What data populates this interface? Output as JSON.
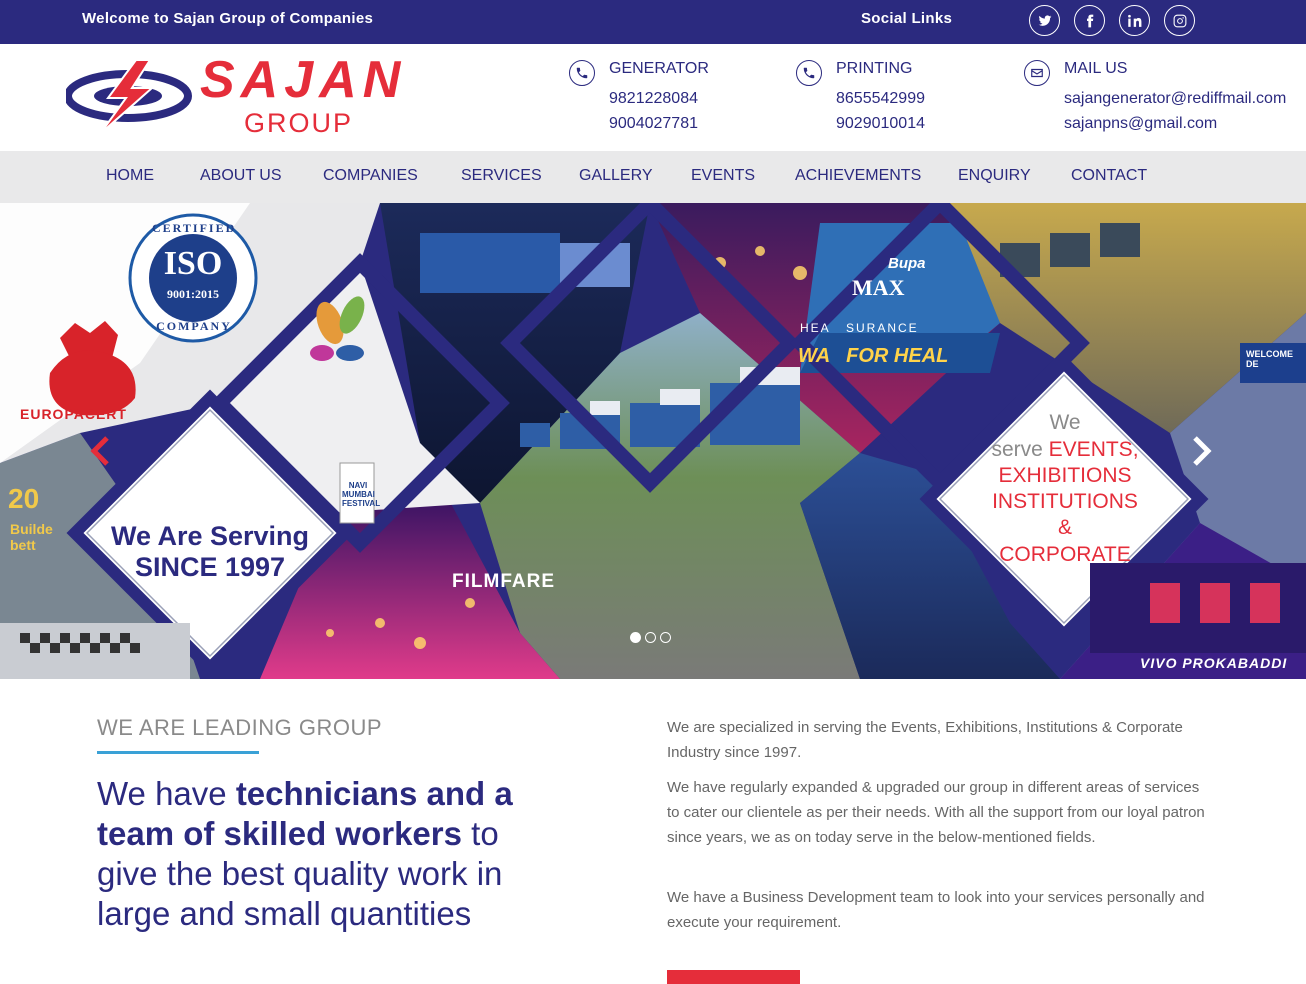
{
  "topbar": {
    "welcome": "Welcome to Sajan Group of Companies",
    "social_label": "Social Links",
    "social_icons": [
      "twitter-icon",
      "facebook-icon",
      "linkedin-icon",
      "instagram-icon"
    ]
  },
  "logo": {
    "word": "SAJAN",
    "sub": "GROUP"
  },
  "contacts": [
    {
      "title": "GENERATOR",
      "lines": [
        "9821228084",
        "9004027781"
      ],
      "icon": "phone-icon"
    },
    {
      "title": "PRINTING",
      "lines": [
        "8655542999",
        "9029010014"
      ],
      "icon": "phone-icon"
    },
    {
      "title": "MAIL US",
      "lines": [
        "sajangenerator@rediffmail.com",
        "sajanpns@gmail.com"
      ],
      "icon": "mail-icon"
    }
  ],
  "nav": [
    "HOME",
    "ABOUT US",
    "COMPANIES",
    "SERVICES",
    "GALLERY",
    "EVENTS",
    "ACHIEVEMENTS",
    "ENQUIRY",
    "CONTACT"
  ],
  "banner": {
    "iso_top": "CERTIFIED",
    "iso_main": "ISO",
    "iso_num": "9001:2015",
    "iso_bottom": "COMPANY",
    "europacert": "EUROPACERT",
    "serving_line1": "We Are Serving",
    "serving_line2": "SINCE 1997",
    "serve_we": "We",
    "serve_line": "serve",
    "serve_events": "EVENTS,",
    "serve_exhibitions": "EXHIBITIONS",
    "serve_institutions": "INSTITUTIONS",
    "serve_amp": "&",
    "serve_corporate": "CORPORATE",
    "filmfare": "FILMFARE",
    "bupa": "Bupa",
    "max": "MAX",
    "insurance": "HEA   SURANCE",
    "walk": "WA   FOR HEAL",
    "welcome_de": "WELCOME DE",
    "navi": "NAVI MUMBAI FESTIVAL",
    "twenty": "20",
    "build": "Builde bett",
    "vivo": "VIVO PROKABADDI",
    "slides_total": 3,
    "slide_active": 1
  },
  "intro": {
    "tagline": "WE ARE LEADING GROUP",
    "headline_1": "We have ",
    "headline_b1": "technicians and a team of skilled workers",
    "headline_2": " to give the best quality work in large and small quantities",
    "para1": "We are specialized in serving the Events, Exhibitions, Institutions & Corporate Industry since 1997.",
    "para2": "We have regularly expanded & upgraded our group in different areas of services to cater our clientele as per their needs. With all the support from our loyal patron since years, we as on today serve in the below-mentioned fields.",
    "para3": "We have a Business Development team to look into your services personally and execute your requirement."
  },
  "colors": {
    "navy": "#2b2a7f",
    "red": "#e52d3a",
    "accent_blue": "#3aa1d6"
  }
}
